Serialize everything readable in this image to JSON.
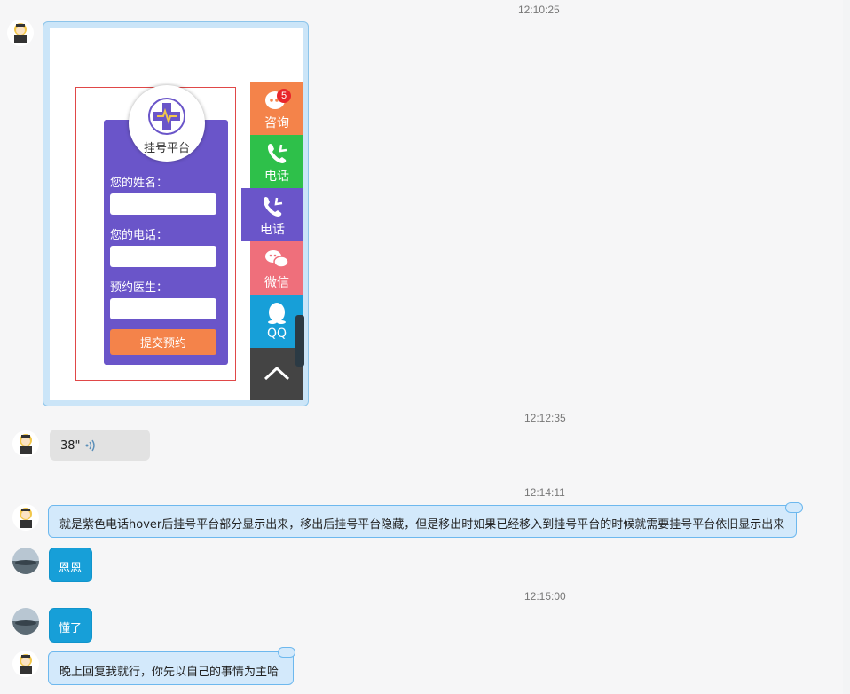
{
  "timestamps": [
    "12:10:25",
    "12:12:35",
    "12:14:11",
    "12:15:00"
  ],
  "screenshot": {
    "logo_text": "挂号平台",
    "form_labels": [
      "您的姓名：",
      "您的电话：",
      "预约医生："
    ],
    "submit_label": "提交预约",
    "side_items": [
      {
        "label": "咨询",
        "color": "#f4834a",
        "icon": "chat-icon",
        "badge": "5"
      },
      {
        "label": "电话",
        "color": "#2ec04a",
        "icon": "phone-icon"
      },
      {
        "label": "电话",
        "color": "#6a55c9",
        "icon": "phone-icon"
      },
      {
        "label": "微信",
        "color": "#ef6f7b",
        "icon": "wechat-icon"
      },
      {
        "label": "QQ",
        "color": "#179fd8",
        "icon": "qq-icon"
      },
      {
        "label": "",
        "color": "#444444",
        "icon": "chevron-up-icon"
      }
    ]
  },
  "messages": {
    "voice": "38\"",
    "m1": "就是紫色电话hover后挂号平台部分显示出来，移出后挂号平台隐藏，但是移出时如果已经移入到挂号平台的时候就需要挂号平台依旧显示出来",
    "m2": "恩恩",
    "m3": "懂了",
    "m4": "晚上回复我就行，你先以自己的事情为主哈"
  },
  "colors": {
    "sent_bubble": "#d3e9fb",
    "reply_bubble": "#179fd8",
    "panel_purple": "#6a55c9",
    "submit_orange": "#f4834a"
  }
}
